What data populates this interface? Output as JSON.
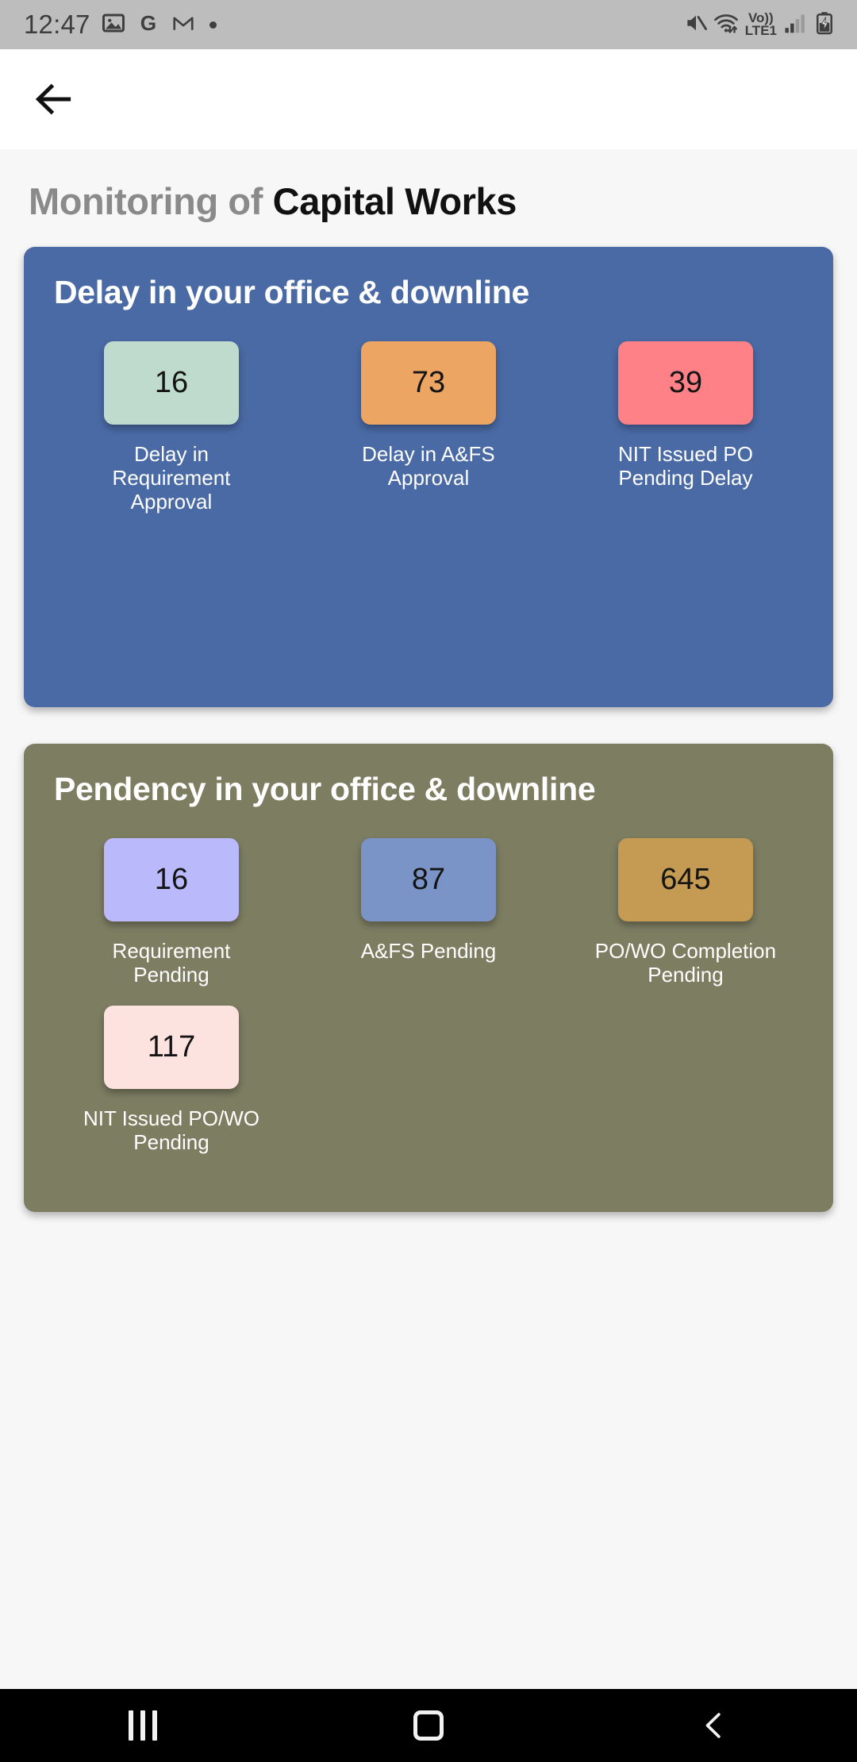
{
  "status_bar": {
    "time": "12:47",
    "left_icons": [
      "photos-icon",
      "google-icon",
      "gmail-icon",
      "dot-icon"
    ],
    "network_label_top": "Vo))",
    "network_label_bottom": "LTE1",
    "right_icons": [
      "mute-icon",
      "wifi-icon",
      "volte-icon",
      "signal-icon",
      "battery-charging-icon"
    ],
    "background_color": "#bdbdbd"
  },
  "app_bar": {
    "back_icon": "arrow-left-icon"
  },
  "page": {
    "title_light": "Monitoring of",
    "title_bold": "Capital Works",
    "background_color": "#f7f7f7"
  },
  "cards": [
    {
      "id": "delay",
      "title": "Delay in your office & downline",
      "background_color": "#4a6aa5",
      "tiles": [
        {
          "value": "16",
          "label": "Delay in Requirement Approval",
          "color": "#bedbce"
        },
        {
          "value": "73",
          "label": "Delay in A&FS Approval",
          "color": "#eda563"
        },
        {
          "value": "39",
          "label": "NIT Issued PO Pending Delay",
          "color": "#fd8186"
        }
      ]
    },
    {
      "id": "pendency",
      "title": "Pendency in your office & downline",
      "background_color": "#7d7d62",
      "tiles": [
        {
          "value": "16",
          "label": "Requirement Pending",
          "color": "#b9b9fb"
        },
        {
          "value": "87",
          "label": "A&FS Pending",
          "color": "#7a94c7"
        },
        {
          "value": "645",
          "label": "PO/WO Completion Pending",
          "color": "#c59a53"
        },
        {
          "value": "117",
          "label": "NIT Issued PO/WO Pending",
          "color": "#fde3e0"
        }
      ]
    }
  ],
  "nav_bar": {
    "buttons": [
      {
        "name": "recents-button",
        "icon": "recents-icon"
      },
      {
        "name": "home-button",
        "icon": "home-icon"
      },
      {
        "name": "back-button",
        "icon": "chevron-left-icon"
      }
    ],
    "background_color": "#000000"
  }
}
